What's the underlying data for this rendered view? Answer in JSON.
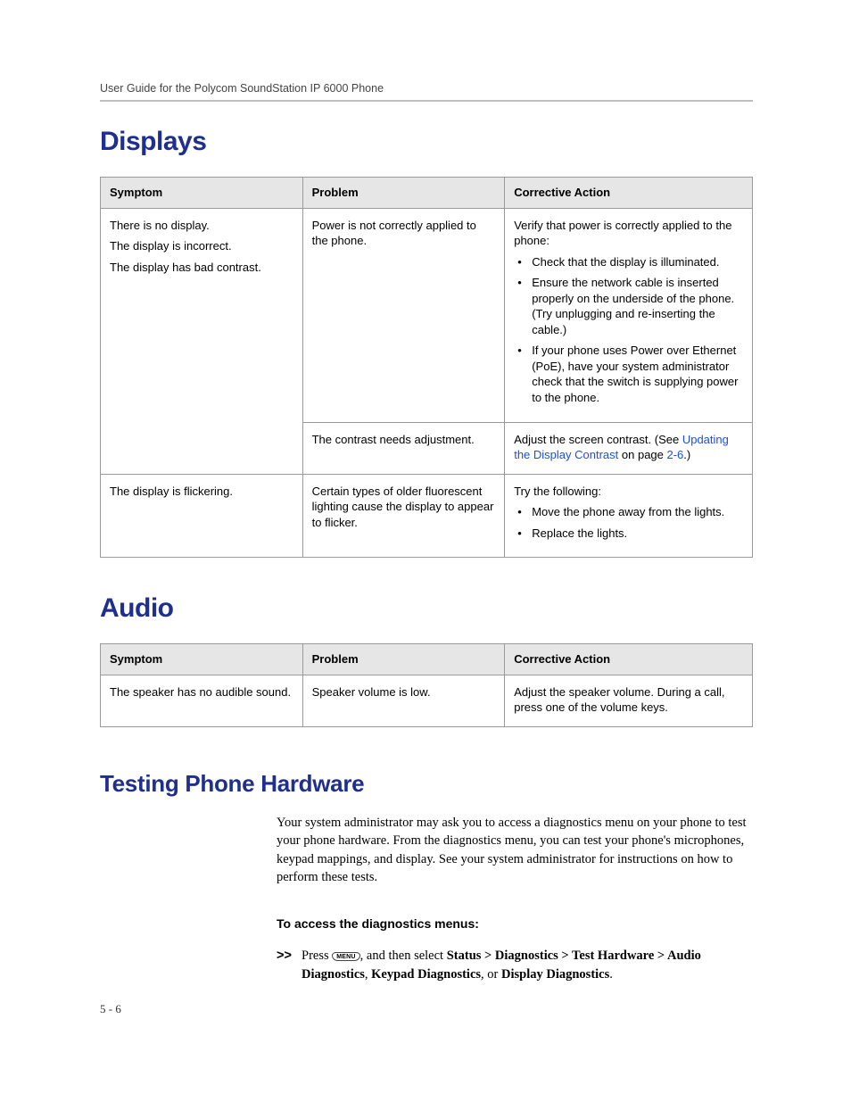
{
  "header": {
    "running_head": "User Guide for the Polycom SoundStation IP 6000 Phone"
  },
  "sections": {
    "displays": {
      "title": "Displays",
      "table": {
        "headers": {
          "c1": "Symptom",
          "c2": "Problem",
          "c3": "Corrective Action"
        },
        "row1": {
          "symptom_a": "There is no display.",
          "symptom_b": "The display is incorrect.",
          "symptom_c": "The display has bad contrast.",
          "problem": "Power is not correctly applied to the phone.",
          "action_intro": "Verify that power is correctly applied to the phone:",
          "bullets": [
            "Check that the display is illuminated.",
            "Ensure the network cable is inserted properly on the underside of the phone. (Try unplugging and re-inserting the cable.)",
            "If your phone uses Power over Ethernet (PoE), have your system administrator check that the switch is supplying power to the phone."
          ]
        },
        "row2": {
          "problem": "The contrast needs adjustment.",
          "action_pre": "Adjust the screen contrast. (See ",
          "action_link1": "Updating the Display Contrast",
          "action_mid": " on page ",
          "action_link2": "2-6",
          "action_post": ".)"
        },
        "row3": {
          "symptom": "The display is flickering.",
          "problem": "Certain types of older fluorescent lighting cause the display to appear to flicker.",
          "action_intro": "Try the following:",
          "bullets": [
            "Move the phone away from the lights.",
            "Replace the lights."
          ]
        }
      }
    },
    "audio": {
      "title": "Audio",
      "table": {
        "headers": {
          "c1": "Symptom",
          "c2": "Problem",
          "c3": "Corrective Action"
        },
        "row1": {
          "symptom": "The speaker has no audible sound.",
          "problem": "Speaker volume is low.",
          "action": "Adjust the speaker volume. During a call, press one of the volume keys."
        }
      }
    },
    "testing": {
      "title": "Testing Phone Hardware",
      "body": "Your system administrator may ask you to access a diagnostics menu on your phone to test your phone hardware. From the diagnostics menu, you can test your phone's microphones, keypad mappings, and display. See your system administrator for instructions on how to perform these tests.",
      "subhead": "To access the diagnostics menus:",
      "step_marker": ">>",
      "step_press": "Press ",
      "menu_key_label": "MENU",
      "step_after_key": ", and then select ",
      "path1": "Status > Diagnostics > Test Hardware > Audio Diagnostics",
      "sep1": ", ",
      "path2": "Keypad Diagnostics",
      "sep2": ", or ",
      "path3": "Display Diagnostics",
      "step_end": "."
    }
  },
  "footer": {
    "page_num": "5 - 6"
  }
}
